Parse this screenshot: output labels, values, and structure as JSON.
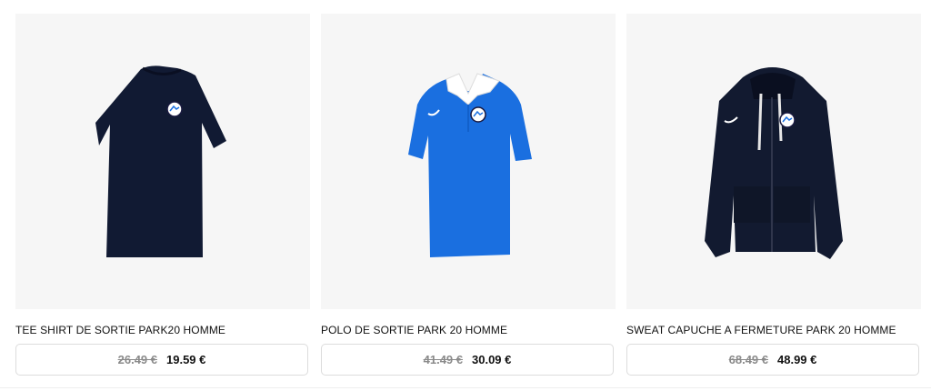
{
  "products": [
    {
      "title": "TEE SHIRT DE SORTIE PARK20 HOMME",
      "old_price": "26.49 €",
      "new_price": "19.59 €",
      "image_icon": "navy-tshirt-icon",
      "color": "#111a33"
    },
    {
      "title": "POLO DE SORTIE PARK 20 HOMME",
      "old_price": "41.49 €",
      "new_price": "30.09 €",
      "image_icon": "blue-polo-icon",
      "color": "#1a6fe0"
    },
    {
      "title": "SWEAT CAPUCHE A FERMETURE PARK 20 HOMME",
      "old_price": "68.49 €",
      "new_price": "48.99 €",
      "image_icon": "navy-hoodie-icon",
      "color": "#121a30"
    }
  ]
}
